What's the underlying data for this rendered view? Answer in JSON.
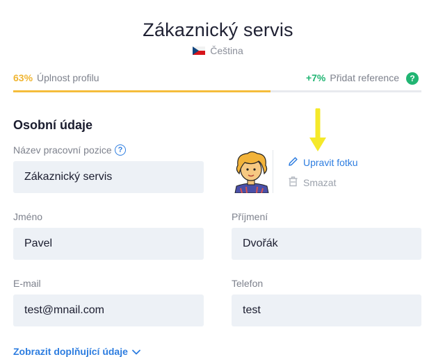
{
  "header": {
    "title": "Zákaznický servis",
    "language": "Čeština"
  },
  "progress": {
    "completeness_pct": "63%",
    "completeness_label": "Úplnost profilu",
    "bonus_pct": "+7%",
    "bonus_label": "Přidat reference",
    "fill_fraction": 0.63
  },
  "personal": {
    "section_title": "Osobní údaje",
    "job_title_label": "Název pracovní pozice",
    "job_title_value": "Zákaznický servis",
    "first_name_label": "Jméno",
    "first_name_value": "Pavel",
    "last_name_label": "Příjmení",
    "last_name_value": "Dvořák",
    "email_label": "E-mail",
    "email_value": "test@mnail.com",
    "phone_label": "Telefon",
    "phone_value": "test"
  },
  "photo": {
    "edit_label": "Upravit fotku",
    "delete_label": "Smazat"
  },
  "more_details": "Zobrazit doplňující údaje",
  "icons": {
    "flag": "czech-flag-icon",
    "help": "question-circle-icon",
    "edit": "pencil-icon",
    "delete": "trash-icon",
    "expand": "chevron-down-icon",
    "arrow": "yellow-arrow-annotation"
  },
  "colors": {
    "accent": "#2d7de0",
    "progress": "#f5bd3b",
    "success": "#21b573",
    "field_bg": "#edf1f6"
  }
}
